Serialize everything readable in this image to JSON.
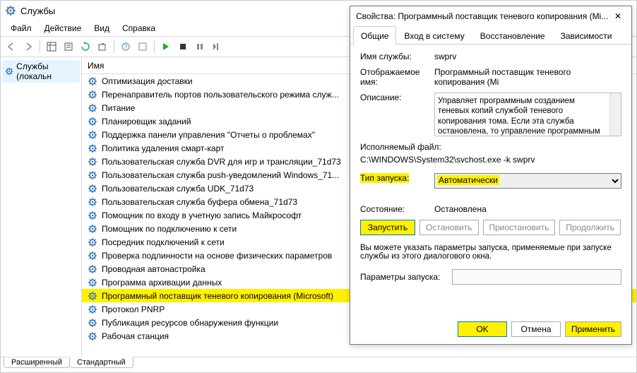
{
  "window": {
    "title": "Службы"
  },
  "menu": {
    "file": "Файл",
    "action": "Действие",
    "view": "Вид",
    "help": "Справка"
  },
  "tree": {
    "root": "Службы (локальн"
  },
  "list": {
    "header": "Имя",
    "items": [
      "Оптимизация доставки",
      "Перенаправитель портов пользовательского режима служ...",
      "Питание",
      "Планировщик заданий",
      "Поддержка панели управления \"Отчеты о проблемах\"",
      "Политика удаления смарт-карт",
      "Пользовательская служба DVR для игр и трансляции_71d73",
      "Пользовательская служба push-уведомлений Windows_71...",
      "Пользовательская служба UDK_71d73",
      "Пользовательская служба буфера обмена_71d73",
      "Помощник по входу в учетную запись Майкрософт",
      "Помощник по подключению к сети",
      "Посредник подключений к сети",
      "Проверка подлинности на основе физических параметров",
      "Проводная автонастройка",
      "Программа архивации данных",
      "Программный поставщик теневого копирования (Microsoft)",
      "Протокол PNRP",
      "Публикация ресурсов обнаружения функции",
      "Рабочая станция"
    ],
    "selectedIndex": 16
  },
  "bottomTabs": {
    "extended": "Расширенный",
    "standard": "Стандартный"
  },
  "dialog": {
    "title": "Свойства: Программный поставщик теневого копирования (Mi...",
    "tabs": {
      "general": "Общие",
      "logon": "Вход в систему",
      "recovery": "Восстановление",
      "deps": "Зависимости"
    },
    "labels": {
      "svcName": "Имя службы:",
      "dispName": "Отображаемое имя:",
      "desc": "Описание:",
      "exe": "Исполняемый файл:",
      "startup": "Тип запуска:",
      "state": "Состояние:",
      "params": "Параметры запуска:",
      "note": "Вы можете указать параметры запуска, применяемые при запуске службы из этого диалогового окна."
    },
    "values": {
      "svcName": "swprv",
      "dispName": "Программный поставщик теневого копирования (Mi",
      "desc": "Управляет программным созданием теневых копий службой теневого копирования тома. Если эта служба остановлена, то управление программным созданием теневых копий",
      "exe": "C:\\WINDOWS\\System32\\svchost.exe -k swprv",
      "startup": "Автоматически",
      "state": "Остановлена"
    },
    "buttons": {
      "start": "Запустить",
      "stop": "Остановить",
      "pause": "Приостановить",
      "resume": "Продолжить",
      "ok": "OK",
      "cancel": "Отмена",
      "apply": "Применить"
    }
  }
}
